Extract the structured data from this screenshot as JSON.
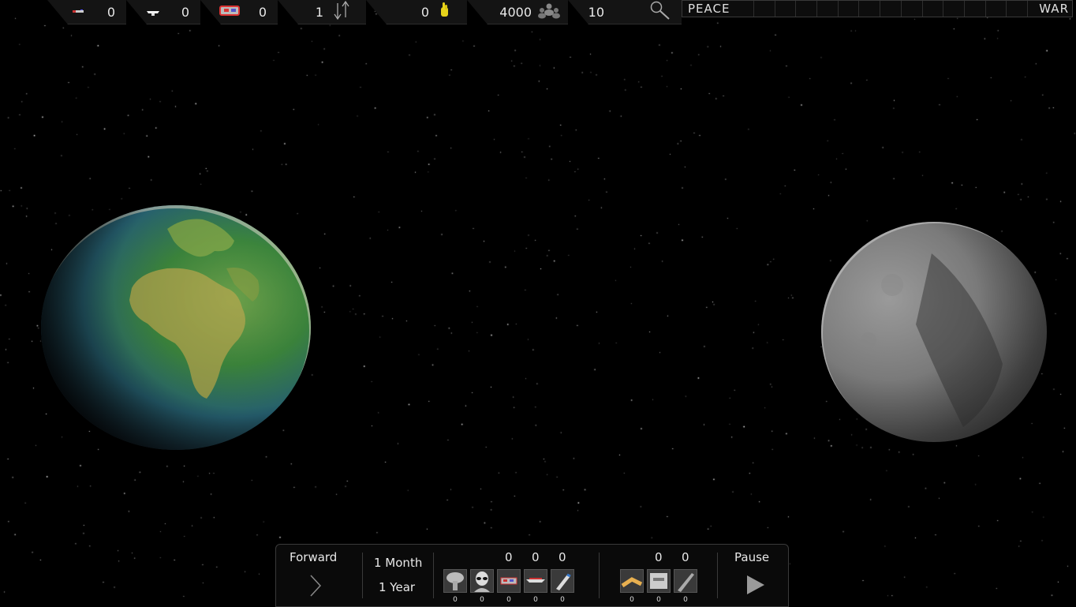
{
  "topbar": {
    "resources": [
      {
        "name": "small-ship",
        "value": "0"
      },
      {
        "name": "white-ship",
        "value": "0"
      },
      {
        "name": "red-ship",
        "value": "0"
      },
      {
        "name": "transfer",
        "value": "1"
      },
      {
        "name": "hand",
        "value": "0"
      },
      {
        "name": "population",
        "value": "4000"
      },
      {
        "name": "research",
        "value": "10"
      }
    ],
    "meter": {
      "left_label": "PEACE",
      "right_label": "WAR"
    }
  },
  "bottom": {
    "forward_label": "Forward",
    "month_label": "1 Month",
    "year_label": "1 Year",
    "group1_totals": [
      "0",
      "0",
      "0"
    ],
    "group1_counts": [
      "0",
      "0",
      "0",
      "0",
      "0"
    ],
    "group2_totals": [
      "0",
      "0"
    ],
    "group2_counts": [
      "0",
      "0",
      "0"
    ],
    "pause_label": "Pause"
  }
}
